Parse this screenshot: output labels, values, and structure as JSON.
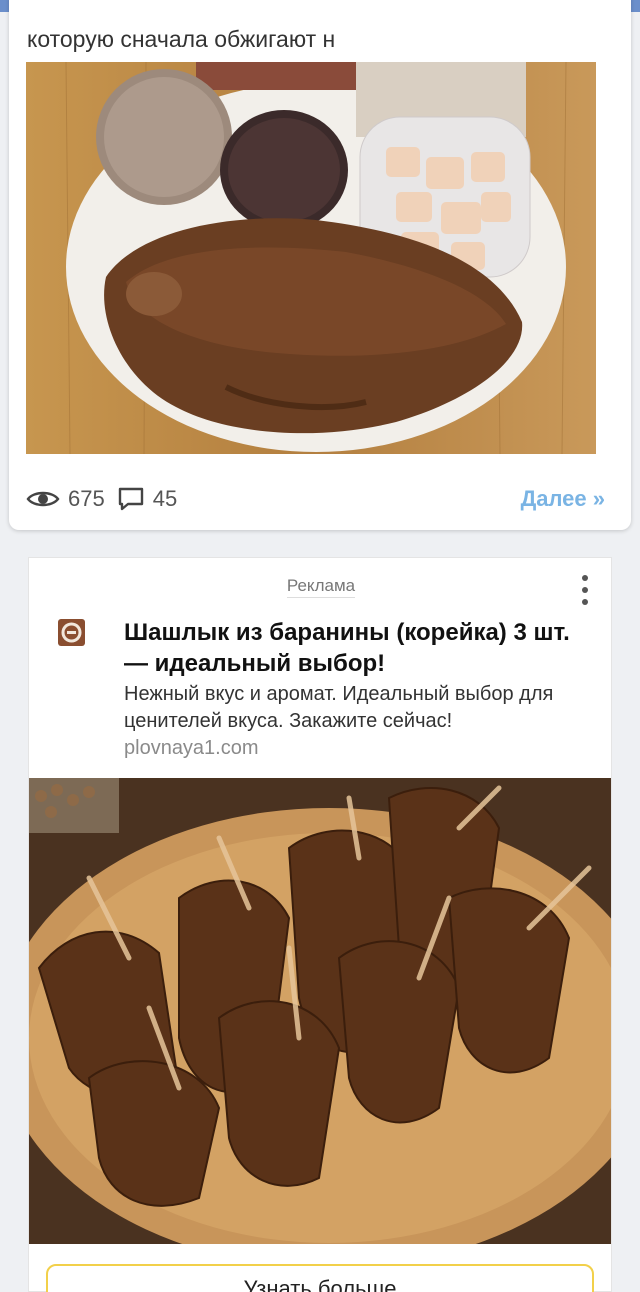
{
  "post": {
    "text": "которую сначала обжигают н",
    "image_alt": "plate-with-smoked-head-sausages-and-lard",
    "views": "675",
    "comments": "45",
    "more_label": "Далее »"
  },
  "ad": {
    "label": "Реклама",
    "title": "Шашлык из баранины (корейка) 3 шт. — идеальный выбор!",
    "description": "Нежный вкус и аромат. Идеальный выбор для ценителей вкуса. Закажите сейчас!",
    "domain": "plovnaya1.com",
    "image_alt": "grilled-lamb-ribs-on-wooden-board",
    "button_label": "Узнать больше"
  },
  "colors": {
    "top_bar": "#6b8fcb",
    "link": "#7ab4e4",
    "button_border": "#f2d04a"
  },
  "icons": [
    "eye-icon",
    "comment-icon",
    "more-vert-icon",
    "brand-logo-icon"
  ]
}
